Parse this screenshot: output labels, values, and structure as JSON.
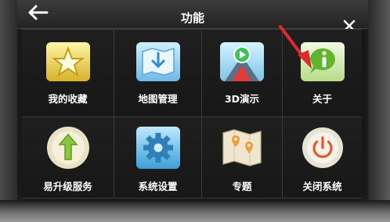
{
  "header": {
    "title": "功能",
    "back_icon": "back-arrow-icon",
    "close_icon": "close-icon"
  },
  "menu": {
    "items": [
      {
        "label": "我的收藏",
        "icon": "star-favorites-icon"
      },
      {
        "label": "地图管理",
        "icon": "map-download-icon"
      },
      {
        "label": "3D演示",
        "icon": "3d-demo-play-icon"
      },
      {
        "label": "关于",
        "icon": "info-icon"
      },
      {
        "label": "易升级服务",
        "icon": "upgrade-arrow-icon"
      },
      {
        "label": "系统设置",
        "icon": "gear-settings-icon"
      },
      {
        "label": "专题",
        "icon": "topic-map-pin-icon"
      },
      {
        "label": "关闭系统",
        "icon": "power-icon"
      }
    ]
  },
  "colors": {
    "annotation_arrow": "#e0282f",
    "background": "#151515",
    "text": "#ffffff"
  }
}
